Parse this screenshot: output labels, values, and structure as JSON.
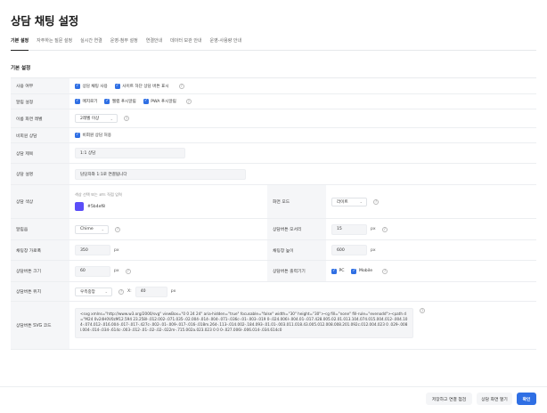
{
  "title": "상담 채팅 설정",
  "tabs": [
    "기본 설정",
    "자주하는 질문 설정",
    "실시간 연결",
    "운영-첨부 설정",
    "연결안내",
    "데이터 보관 안내",
    "운영-사용량 안내"
  ],
  "section_title": "기본 설정",
  "rows": {
    "usage": {
      "label": "사용 여부",
      "chk1": "상담 채팅 사용",
      "chk2": "사이트 하단 상담 버튼 표시"
    },
    "alert": {
      "label": "알림 설정",
      "chk1": "메지로기",
      "chk2": "웹랩 푸시알림",
      "chk3": "PWA 푸시알림"
    },
    "retention": {
      "label": "이름 화면 레벨",
      "value": "2레벨 이상"
    },
    "nonmember": {
      "label": "비회원 상담",
      "chk1": "비회원 상담 허용"
    },
    "consult_title": {
      "label": "상담 제목",
      "value": "1:1 상담"
    },
    "consult_desc": {
      "label": "상담 설명",
      "value": "담당자와 1:1로 연결됩니다"
    },
    "color": {
      "label": "상담 색상",
      "hint": "색상 선택 또는 코드 직접 입력",
      "value": "#5b4ef8",
      "swatch": "#5b4ef8"
    },
    "screen_mode": {
      "label": "화면 모드",
      "value": "라이트"
    },
    "icon": {
      "label": "알림음",
      "value": "Chime"
    },
    "btn_pos": {
      "label": "상담버튼 모서리",
      "value": "15",
      "unit": "px"
    },
    "width": {
      "label": "채팅창 가로폭",
      "value": "350",
      "unit": "px"
    },
    "height": {
      "label": "채팅창 높이",
      "value": "600",
      "unit": "px"
    },
    "btn_size": {
      "label": "상담버튼 크기",
      "value": "60",
      "unit": "px"
    },
    "btn_show": {
      "label": "상담버튼 출력기기",
      "chk1": "PC",
      "chk2": "Mobile"
    },
    "btn_location": {
      "label": "상담버튼 위치",
      "value": "우측중앙",
      "x_label": "X:",
      "x_value": "40",
      "unit": "px"
    },
    "svg_code": {
      "label": "상담버튼 SVG 코드",
      "value": "<svg xmlns=\"http://www.w3.org/2000/svg\" viewBox=\"0 0 24 24\" aria-hidden=\"true\" focusable=\"false\" width=\"30\" height=\"30\"><g fill=\"none\" fill-rule=\"evenodd\"><path d=\"M24 0v24H0V0zM12.594 23.258l-.012.002-.071.035-.02.004-.014-.004-.071-.036c-.01-.003-.019 0-.024.006l-.004.01-.017.428.005.02.01.013.104.074.015.004.012-.004.104-.074.012-.016.004-.017-.017-.427c-.002-.01-.009-.017-.016-.018m.264-.113-.014.002-.184.093-.01.01-.003.011.018.43.005.012.008.008.201.092c.012.004.023 0 .029-.008l.004-.014-.034-.614c-.003-.012-.01-.02-.02-.022m-.715.002a.023.023 0 0 0-.027.006l-.006.014-.034.614c0"
    }
  },
  "buttons": {
    "save_preview": "저장하고 연결 점검",
    "open_screen": "상담 화면 열기",
    "confirm": "확인"
  },
  "colors": {
    "accent": "#2f6fe4",
    "swatch": "#5b4ef8"
  }
}
